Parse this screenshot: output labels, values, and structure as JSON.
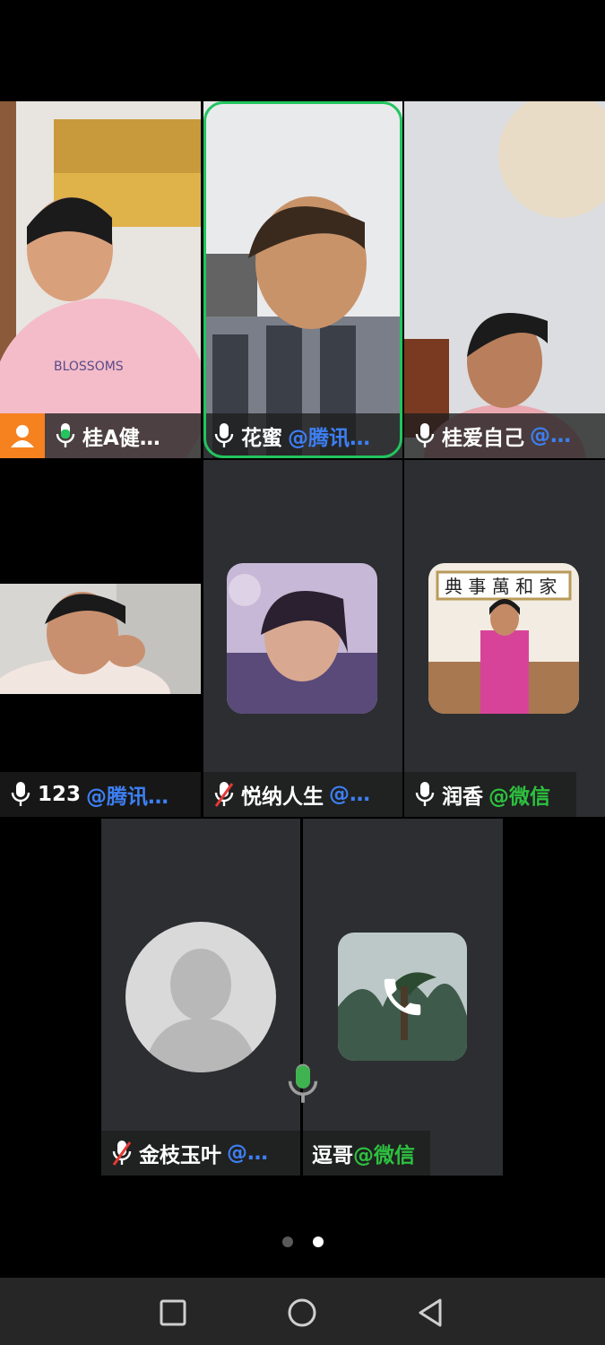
{
  "tiles": [
    {
      "name": "桂A健…",
      "source": "",
      "mic": "on",
      "host": true
    },
    {
      "name": "花蜜",
      "source": "@腾讯…",
      "source_color": "#3d7ff2",
      "mic": "on",
      "speaking": true
    },
    {
      "name": "桂爱自己",
      "source": "@…",
      "source_color": "#3d7ff2",
      "mic": "on"
    },
    {
      "name": "123",
      "source": "@腾讯…",
      "source_color": "#3d7ff2",
      "mic": "on"
    },
    {
      "name": "悦纳人生",
      "source": "@…",
      "source_color": "#3d7ff2",
      "mic": "muted"
    },
    {
      "name": "润香",
      "source": "@微信",
      "source_color": "#2dc13f",
      "mic": "on"
    },
    {
      "name": "金枝玉叶",
      "source": "@…",
      "source_color": "#3d7ff2",
      "mic": "muted"
    },
    {
      "name": "逗哥",
      "source": "@微信",
      "source_color": "#2dc13f",
      "mic": "calling"
    }
  ],
  "pager": {
    "pages": 2,
    "current": 2
  },
  "icons": {
    "mic": "microphone-icon",
    "muted": "mic-muted-icon",
    "host": "host-person-icon",
    "call": "phone-icon",
    "nav_back": "back-triangle-icon",
    "nav_home": "home-circle-icon",
    "nav_recent": "recents-square-icon"
  },
  "colors": {
    "speaking_border": "#22c55e",
    "host_badge": "#f5821f",
    "tencent": "#3d7ff2",
    "wechat": "#2dc13f"
  }
}
